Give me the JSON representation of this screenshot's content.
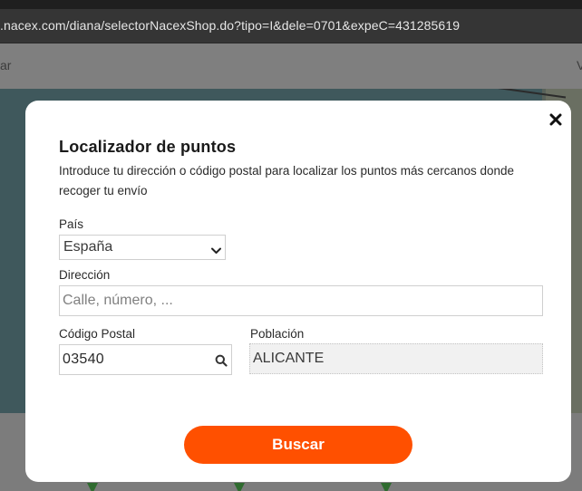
{
  "browser": {
    "url": ".nacex.com/diana/selectorNacexShop.do?tipo=I&dele=0701&expeC=431285619"
  },
  "background": {
    "header_left_fragment": "ar",
    "header_right_fragment": "V"
  },
  "modal": {
    "title": "Localizador de puntos",
    "description": "Introduce tu dirección o código postal para localizar los puntos más cercanos donde recoger tu envío",
    "close_icon": "close-icon",
    "pais": {
      "label": "País",
      "selected": "España"
    },
    "direccion": {
      "label": "Dirección",
      "placeholder": "Calle, número, ...",
      "value": ""
    },
    "codigo_postal": {
      "label": "Código Postal",
      "value": "03540"
    },
    "poblacion": {
      "label": "Población",
      "value": "ALICANTE"
    },
    "search_button_label": "Buscar"
  },
  "colors": {
    "accent": "#ff5000",
    "overlay": "#7f7f7f",
    "modal_bg": "#ffffff"
  }
}
